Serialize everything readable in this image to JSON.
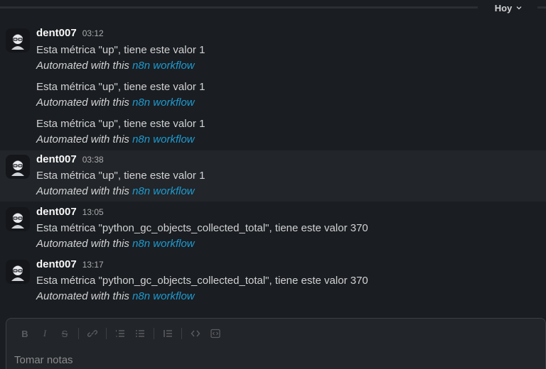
{
  "date_divider": {
    "label": "Hoy"
  },
  "colors": {
    "background": "#1a1d21",
    "link": "#1d9bd1",
    "hover_row": "#222529"
  },
  "messages": [
    {
      "author": "dent007",
      "time": "03:12",
      "lines": [
        {
          "text": "Esta métrica \"up\", tiene este valor  1",
          "footer_prefix": "Automated with this ",
          "footer_link": "n8n workflow"
        },
        {
          "text": "Esta métrica \"up\", tiene este valor  1",
          "footer_prefix": "Automated with this ",
          "footer_link": "n8n workflow"
        },
        {
          "text": "Esta métrica \"up\", tiene este valor  1",
          "footer_prefix": "Automated with this ",
          "footer_link": "n8n workflow"
        }
      ]
    },
    {
      "author": "dent007",
      "time": "03:38",
      "lines": [
        {
          "text": "Esta métrica \"up\", tiene este valor  1",
          "footer_prefix": "Automated with this ",
          "footer_link": "n8n workflow"
        }
      ]
    },
    {
      "author": "dent007",
      "time": "13:05",
      "lines": [
        {
          "text": "Esta métrica \"python_gc_objects_collected_total\", tiene este valor  370",
          "footer_prefix": "Automated with this ",
          "footer_link": "n8n workflow"
        }
      ]
    },
    {
      "author": "dent007",
      "time": "13:17",
      "lines": [
        {
          "text": "Esta métrica \"python_gc_objects_collected_total\", tiene este valor  370",
          "footer_prefix": "Automated with this ",
          "footer_link": "n8n workflow"
        }
      ]
    }
  ],
  "composer": {
    "placeholder": "Tomar notas",
    "toolbar": [
      "bold-icon",
      "italic-icon",
      "strikethrough-icon",
      "link-icon",
      "ordered-list-icon",
      "bulleted-list-icon",
      "blockquote-icon",
      "code-icon",
      "code-block-icon"
    ]
  }
}
